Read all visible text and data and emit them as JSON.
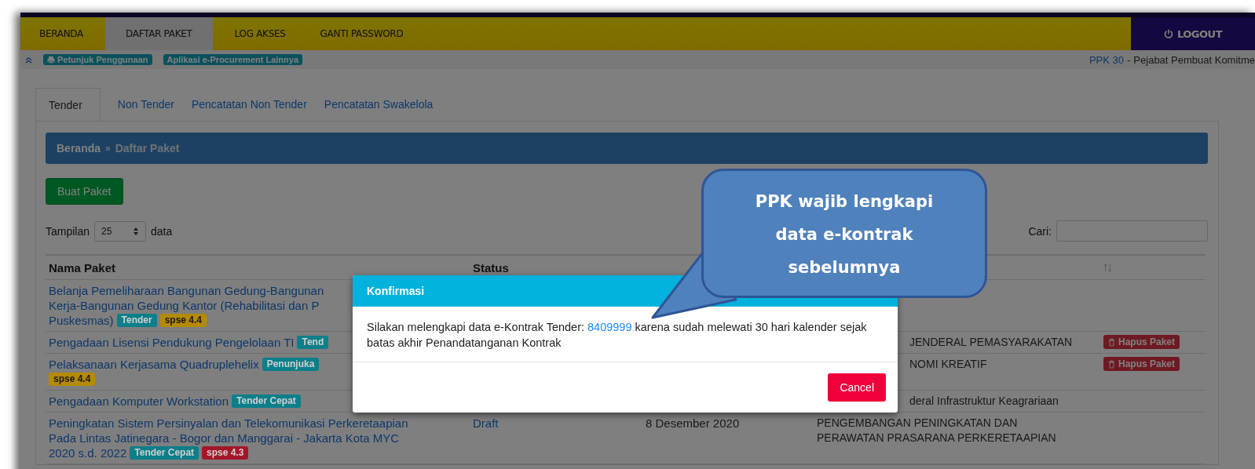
{
  "nav": {
    "items": [
      {
        "label": "BERANDA",
        "selected": false
      },
      {
        "label": "DAFTAR PAKET",
        "selected": true
      },
      {
        "label": "LOG AKSES",
        "selected": false
      },
      {
        "label": "GANTI PASSWORD",
        "selected": false
      }
    ],
    "logout": "LOGOUT"
  },
  "infobar": {
    "links": [
      "Petunjuk Penggunaan",
      "Aplikasi e-Procurement Lainnya"
    ],
    "user_code": "PPK 30",
    "separator": "-",
    "user_role": "Pejabat Pembuat Komitme"
  },
  "tabs": [
    {
      "label": "Tender",
      "selected": true
    },
    {
      "label": "Non Tender",
      "selected": false
    },
    {
      "label": "Pencatatan Non Tender",
      "selected": false
    },
    {
      "label": "Pencatatan Swakelola",
      "selected": false
    }
  ],
  "breadcrumb": {
    "home": "Beranda",
    "separator": "»",
    "current": "Daftar Paket"
  },
  "create_button": "Buat Paket",
  "length": {
    "label_before": "Tampilan",
    "value": "25",
    "label_after": "data"
  },
  "search": {
    "label": "Cari:"
  },
  "table": {
    "columns": [
      "Nama Paket",
      "Status"
    ],
    "rows": [
      {
        "lines": [
          {
            "text": "Belanja Pemeliharaan Bangunan Gedung-Bangunan"
          },
          {
            "text": "Kerja-Bangunan Gedung Kantor (Rehabilitasi dan P"
          },
          {
            "text": "Puskesmas)",
            "badges": [
              {
                "text": "Tender",
                "color": "#0b7f8a"
              },
              {
                "text": "spse 4.4",
                "color": "#b58a04"
              }
            ]
          }
        ]
      },
      {
        "lines": [
          {
            "text": "Pengadaan Lisensi Pendukung Pengelolaan TI",
            "badges": [
              {
                "text": "Tend",
                "color": "#0b7f8a"
              }
            ]
          }
        ],
        "unit_lines": [
          "JENDERAL PEMASYARAKATAN"
        ],
        "unit_covered": true,
        "action": "Hapus Paket"
      },
      {
        "lines": [
          {
            "text": "Pelaksanaan Kerjasama Quadruplehelix",
            "badges": [
              {
                "text": "Penunjuka",
                "color": "#0b7f8a"
              }
            ]
          },
          {
            "badges": [
              {
                "text": "spse 4.4",
                "color": "#b58a04"
              }
            ]
          }
        ],
        "unit_lines": [
          "NOMI KREATIF"
        ],
        "unit_covered": true,
        "action": "Hapus Paket"
      },
      {
        "lines": [
          {
            "text": "Pengadaan Komputer Workstation",
            "badges": [
              {
                "text": "Tender Cepat",
                "color": "#0b7f8a"
              }
            ]
          }
        ],
        "unit_lines": [
          "deral Infrastruktur Keagrariaan"
        ],
        "unit_covered": true
      },
      {
        "lines": [
          {
            "text": "Peningkatan Sistem Persinyalan dan Telekomunikasi Perkeretaapian"
          },
          {
            "text": "Pada Lintas Jatinegara - Bogor dan Manggarai - Jakarta Kota MYC"
          },
          {
            "text": "2020 s.d. 2022",
            "badges": [
              {
                "text": "Tender Cepat",
                "color": "#0b7f8a"
              },
              {
                "text": "spse 4.3",
                "color": "#a3162a"
              }
            ]
          }
        ],
        "status": "Draft",
        "date": "8 Desember 2020",
        "unit_lines": [
          "PENGEMBANGAN PENINGKATAN DAN",
          "PERAWATAN PRASARANA PERKERETAAPIAN"
        ],
        "unit_covered": false
      }
    ]
  },
  "modal": {
    "title": "Konfirmasi",
    "message_before": "Silakan melengkapi data e-Kontrak Tender:",
    "message_link": "8409999",
    "message_after": "karena sudah melewati 30 hari kalender sejak batas akhir Penandatanganan Kontrak",
    "cancel": "Cancel"
  },
  "callout": {
    "lines": [
      "PPK wajib lengkapi",
      "data e-kontrak",
      "sebelumnya"
    ]
  }
}
